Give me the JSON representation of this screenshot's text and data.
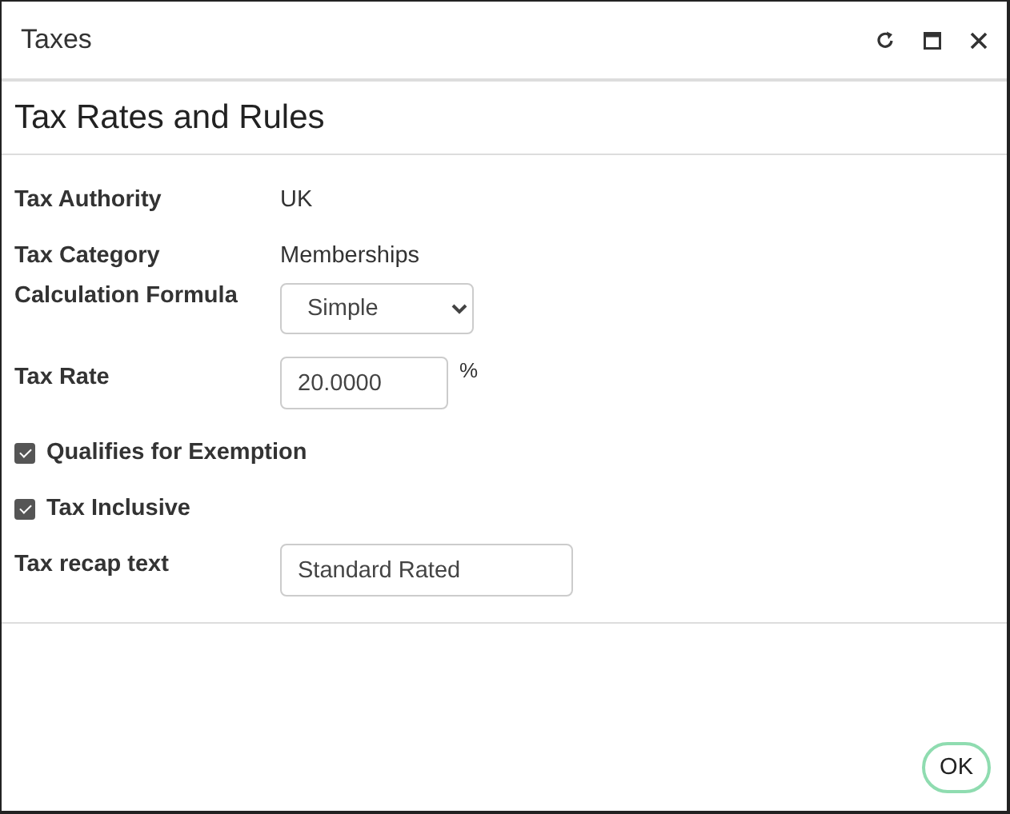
{
  "window": {
    "title": "Taxes"
  },
  "heading": "Tax Rates and Rules",
  "fields": [
    {
      "kind": "text",
      "label": "Tax Authority",
      "value": "UK"
    },
    {
      "kind": "text",
      "label": "Tax Category",
      "value": "Memberships"
    },
    {
      "kind": "select",
      "label": "Calculation Formula",
      "value": "Simple"
    },
    {
      "kind": "input",
      "label": "Tax Rate",
      "value": "20.0000",
      "suffix": "%"
    },
    {
      "kind": "checkbox",
      "label": "Qualifies for Exemption",
      "checked": true
    },
    {
      "kind": "checkbox",
      "label": "Tax Inclusive",
      "checked": true
    },
    {
      "kind": "wide_input",
      "label": "Tax recap text",
      "value": "Standard Rated"
    }
  ],
  "buttons": [
    "OK"
  ]
}
